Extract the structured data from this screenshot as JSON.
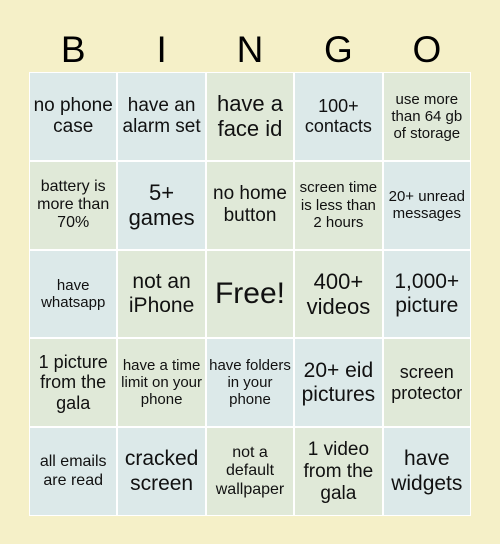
{
  "header": [
    "B",
    "I",
    "N",
    "G",
    "O"
  ],
  "cells": [
    {
      "text": "no phone case",
      "color": "blue"
    },
    {
      "text": "have an alarm set",
      "color": "blue"
    },
    {
      "text": "have a face id",
      "color": "green"
    },
    {
      "text": "100+ contacts",
      "color": "blue"
    },
    {
      "text": "use more than 64 gb of storage",
      "color": "green"
    },
    {
      "text": "battery is more than 70%",
      "color": "green"
    },
    {
      "text": "5+ games",
      "color": "blue"
    },
    {
      "text": "no home button",
      "color": "green"
    },
    {
      "text": "screen time is less than 2 hours",
      "color": "green"
    },
    {
      "text": "20+ unread messages",
      "color": "blue"
    },
    {
      "text": "have whatsapp",
      "color": "blue"
    },
    {
      "text": "not an iPhone",
      "color": "green"
    },
    {
      "text": "Free!",
      "color": "green"
    },
    {
      "text": "400+ videos",
      "color": "green"
    },
    {
      "text": "1,000+ picture",
      "color": "blue"
    },
    {
      "text": "1 picture from the gala",
      "color": "green"
    },
    {
      "text": "have a time limit on your phone",
      "color": "green"
    },
    {
      "text": "have folders in your phone",
      "color": "blue"
    },
    {
      "text": "20+ eid pictures",
      "color": "blue"
    },
    {
      "text": "screen protector",
      "color": "green"
    },
    {
      "text": "all emails are read",
      "color": "blue"
    },
    {
      "text": "cracked screen",
      "color": "blue"
    },
    {
      "text": "not a default wallpaper",
      "color": "green"
    },
    {
      "text": "1 video from the gala",
      "color": "green"
    },
    {
      "text": "have widgets",
      "color": "blue"
    }
  ],
  "colors": {
    "background": "#f5f0c8",
    "cell_blue": "#dce9e9",
    "cell_green": "#e0e9d8",
    "grid_line": "#ffffff"
  }
}
